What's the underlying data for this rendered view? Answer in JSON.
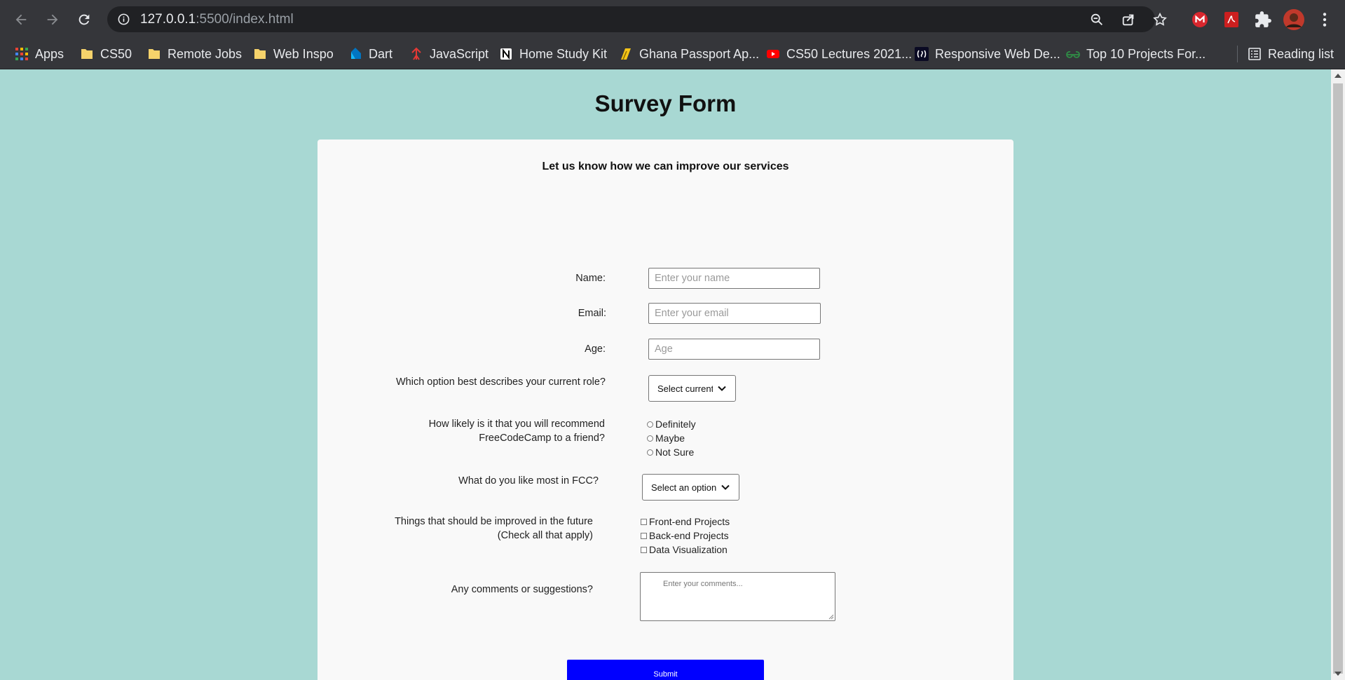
{
  "browser": {
    "url_host": "127.0.0.1",
    "url_rest": ":5500/index.html",
    "bookmarks": [
      {
        "label": "Apps",
        "icon": "apps-grid-icon"
      },
      {
        "label": "CS50",
        "icon": "folder-icon"
      },
      {
        "label": "Remote Jobs",
        "icon": "folder-icon"
      },
      {
        "label": "Web Inspo",
        "icon": "folder-icon"
      },
      {
        "label": "Dart",
        "icon": "dart-logo-icon"
      },
      {
        "label": "JavaScript",
        "icon": "javascript-site-icon"
      },
      {
        "label": "Home Study Kit",
        "icon": "notion-logo-icon"
      },
      {
        "label": "Ghana Passport Ap...",
        "icon": "ghana-passport-icon"
      },
      {
        "label": "CS50 Lectures 2021...",
        "icon": "youtube-icon"
      },
      {
        "label": "Responsive Web De...",
        "icon": "freecodecamp-icon"
      },
      {
        "label": "Top 10 Projects For...",
        "icon": "geeksforgeeks-icon"
      }
    ],
    "reading_list_label": "Reading list"
  },
  "page": {
    "title": "Survey Form",
    "subtitle": "Let us know how we can improve our services",
    "name_label": "Name:",
    "name_placeholder": "Enter your name",
    "email_label": "Email:",
    "email_placeholder": "Enter your email",
    "age_label": "Age:",
    "age_placeholder": "Age",
    "role_label": "Which option best describes your current role?",
    "role_selected": "Select current role",
    "recommend_label_1": "How likely is it that you will recommend",
    "recommend_label_2": "FreeCodeCamp to a friend?",
    "recommend_options": [
      "Definitely",
      "Maybe",
      "Not Sure"
    ],
    "like_label": "What do you like most in FCC?",
    "like_selected": "Select an option",
    "improve_label_1": "Things that should be improved in the future",
    "improve_label_2": "(Check all that apply)",
    "improve_options": [
      "Front-end Projects",
      "Back-end Projects",
      "Data Visualization"
    ],
    "comments_label": "Any comments or suggestions?",
    "comments_placeholder": "Enter your comments...",
    "submit_label": "Submit"
  },
  "colors": {
    "page_background": "#a8d8d3",
    "card_background": "#f9f9f9",
    "submit_button": "#0000ff",
    "chrome_toolbar": "#35363a"
  }
}
